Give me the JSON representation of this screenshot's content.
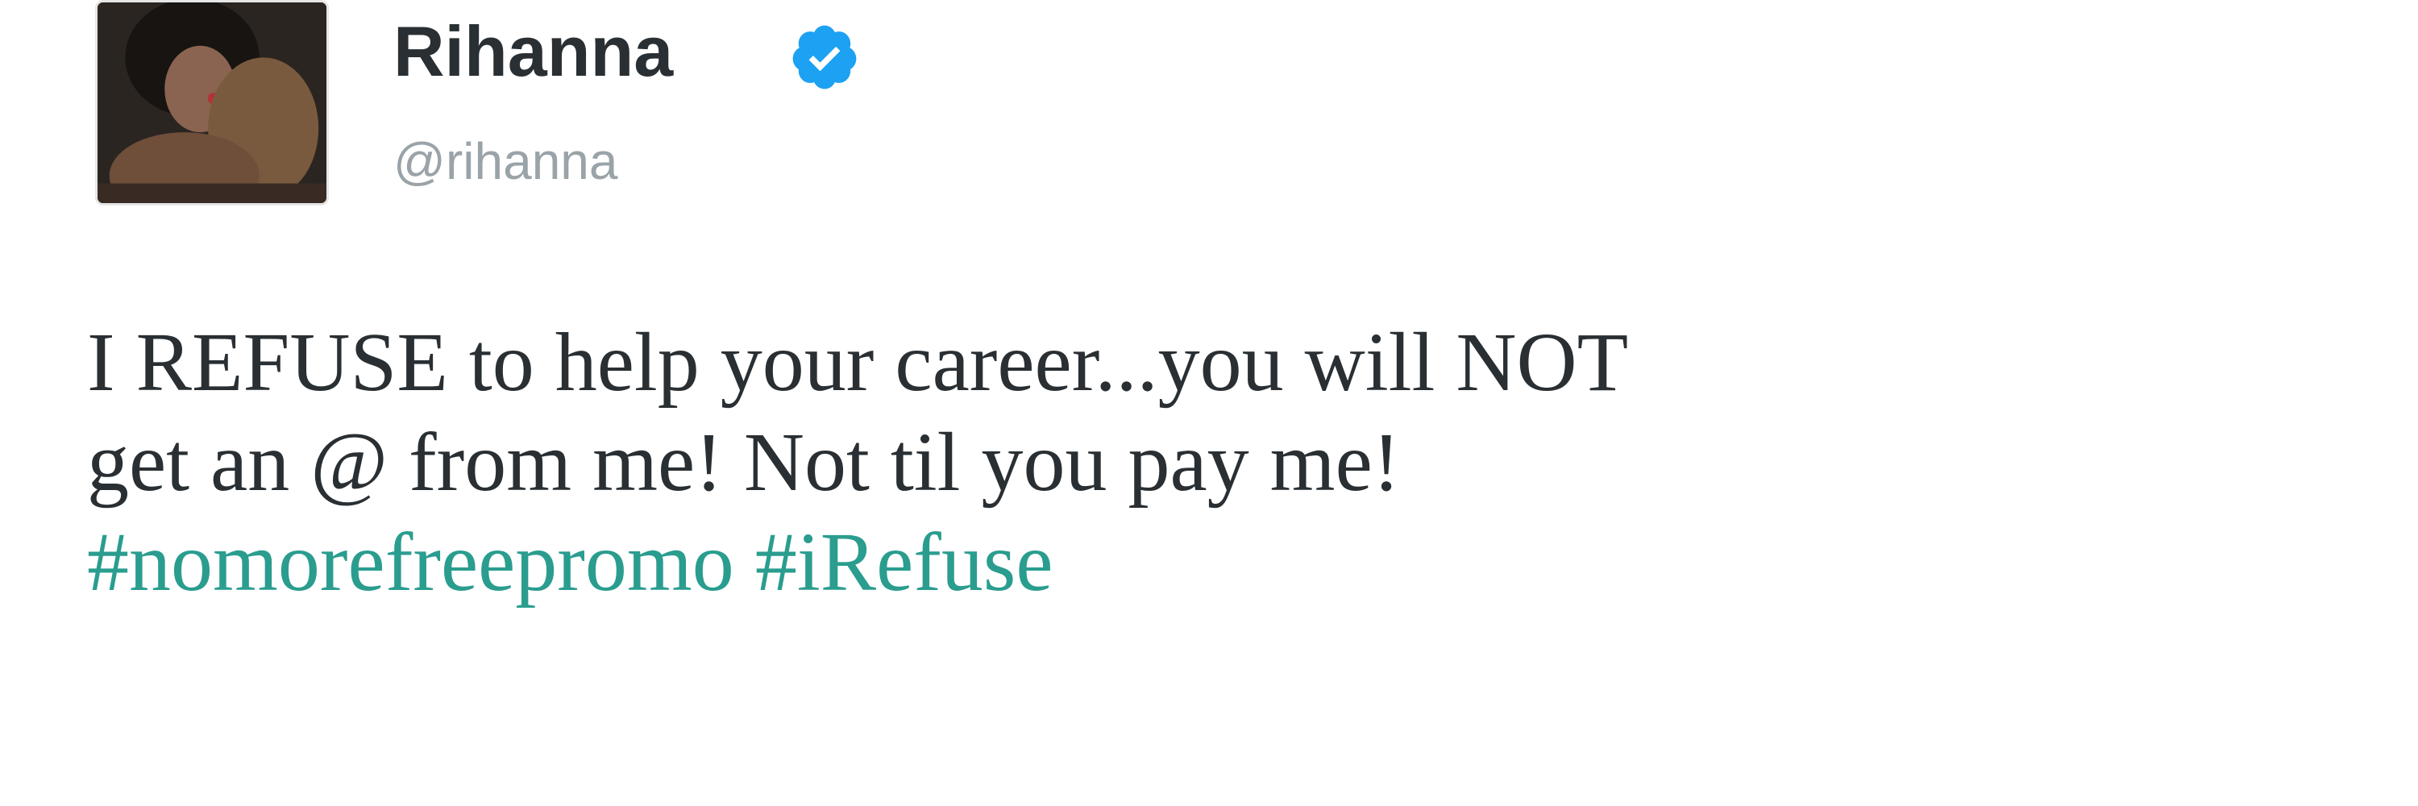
{
  "tweet": {
    "display_name": "Rihanna",
    "handle": "@rihanna",
    "verified": true,
    "text_line1": "I REFUSE to help your career...you will NOT",
    "text_line2": "get an @ from me! Not til you pay me!",
    "hashtags": [
      "#nomorefreepromo",
      "#iRefuse"
    ]
  },
  "icons": {
    "avatar": "profile-photo",
    "verified": "verified-badge-icon"
  },
  "colors": {
    "name": "#292f33",
    "handle": "#9aa3a8",
    "hashtag": "#2a9d8f",
    "verified": "#1da1f2"
  }
}
